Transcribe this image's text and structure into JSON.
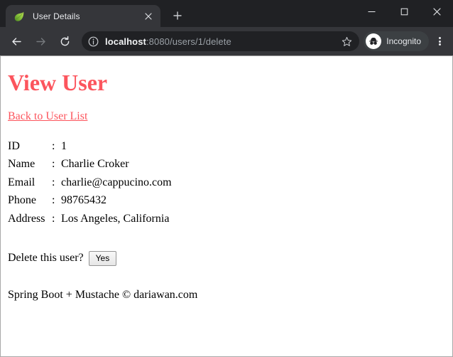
{
  "browser": {
    "tab": {
      "title": "User Details",
      "favicon": "spring-boot-leaf-icon",
      "close_label": "×"
    },
    "new_tab_label": "+",
    "window_controls": {
      "minimize": "–",
      "maximize": "□",
      "close": "×"
    },
    "nav": {
      "back": "←",
      "forward": "→",
      "reload": "↻"
    },
    "omnibox": {
      "site_info_icon": "info-circle-icon",
      "url_host": "localhost",
      "url_path": ":8080/users/1/delete",
      "full_url": "localhost:8080/users/1/delete"
    },
    "bookmark_icon": "star-icon",
    "profile": {
      "label": "Incognito",
      "icon": "incognito-spy-icon"
    },
    "menu_icon": "three-dot-menu-icon"
  },
  "page": {
    "heading": "View User",
    "back_link": "Back to User List",
    "separator": ":",
    "details": [
      {
        "label": "ID",
        "value": "1"
      },
      {
        "label": "Name",
        "value": "Charlie Croker"
      },
      {
        "label": "Email",
        "value": "charlie@cappucino.com"
      },
      {
        "label": "Phone",
        "value": "98765432"
      },
      {
        "label": "Address",
        "value": "Los Angeles, California"
      }
    ],
    "delete_prompt": "Delete this user?",
    "delete_button": "Yes",
    "footer": "Spring Boot + Mustache © dariawan.com",
    "accent_color": "#fc555d",
    "link_color": "#fc555d"
  }
}
